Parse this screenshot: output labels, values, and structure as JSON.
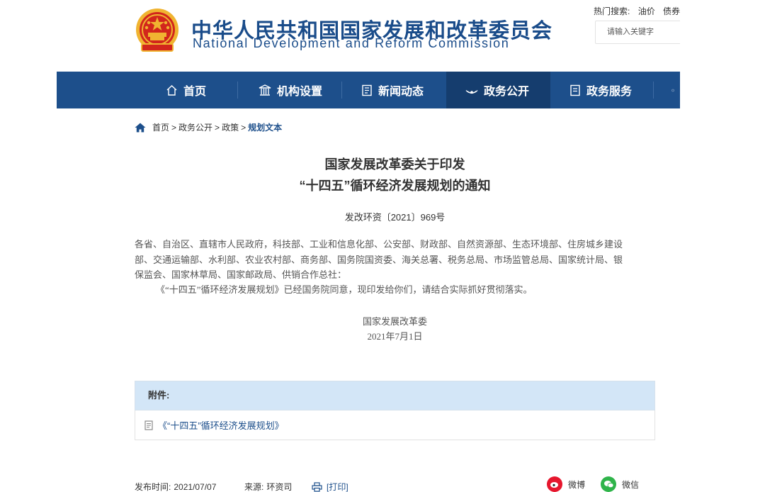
{
  "header": {
    "title_cn": "中华人民共和国国家发展和改革委员会",
    "title_en": "National Development and Reform Commission",
    "hot_label": "热门搜索:",
    "hot_terms": [
      "油价",
      "债券"
    ],
    "search_placeholder": "请输入关键字"
  },
  "nav": {
    "items": [
      {
        "label": "首页",
        "icon": "home-icon"
      },
      {
        "label": "机构设置",
        "icon": "building-icon"
      },
      {
        "label": "新闻动态",
        "icon": "news-icon"
      },
      {
        "label": "政务公开",
        "icon": "broadcast-icon",
        "active": true
      },
      {
        "label": "政务服务",
        "icon": "document-icon"
      }
    ]
  },
  "breadcrumb": {
    "items": [
      "首页",
      "政务公开",
      "政策",
      "规划文本"
    ],
    "separator": ">"
  },
  "article": {
    "title_line1": "国家发展改革委关于印发",
    "title_line2": "“十四五”循环经济发展规划的通知",
    "doc_number": "发改环资〔2021〕969号",
    "recipients_line1": "各省、自治区、直辖市人民政府，科技部、工业和信息化部、公安部、财政部、自然资源部、生态环境部、住房城乡建设",
    "recipients_line2": "部、交通运输部、水利部、农业农村部、商务部、国务院国资委、海关总署、税务总局、市场监管总局、国家统计局、银",
    "recipients_line3": "保监会、国家林草局、国家邮政局、供销合作总社：",
    "body": "《“十四五”循环经济发展规划》已经国务院同意，现印发给你们，请结合实际抓好贯彻落实。",
    "signer": "国家发展改革委",
    "date": "2021年7月1日"
  },
  "attachment": {
    "header": "附件:",
    "file": "《“十四五”循环经济发展规划》"
  },
  "footer": {
    "publish_label": "发布时间:",
    "publish_date": "2021/07/07",
    "source_label": "来源:",
    "source": "环资司",
    "print": "[打印]",
    "weibo": "微博",
    "wechat": "微信"
  },
  "colors": {
    "brand_blue": "#1d4f8b",
    "nav_active": "#153d6e",
    "attachment_header_bg": "#d3e6f7",
    "emblem_red": "#d2261c",
    "emblem_gold": "#f0b431"
  }
}
